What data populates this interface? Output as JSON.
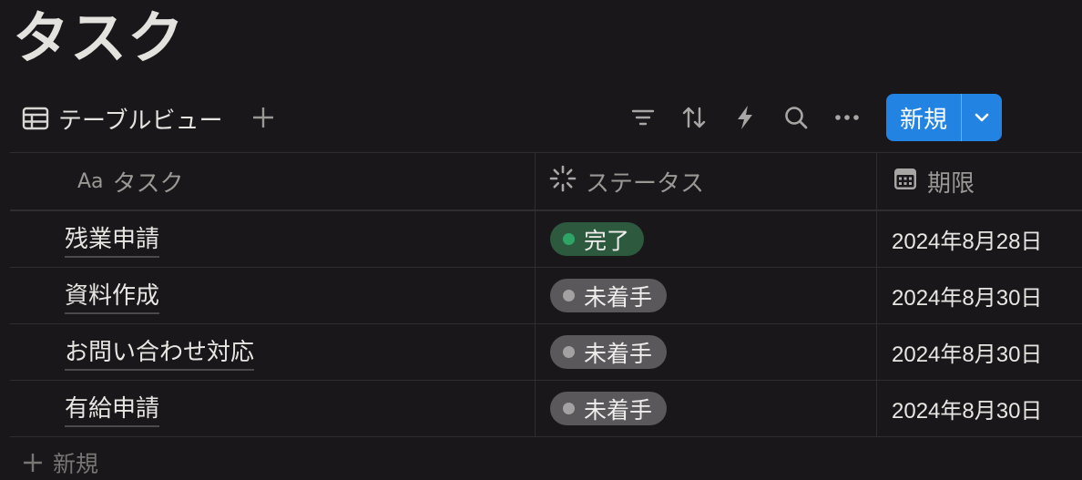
{
  "page": {
    "title": "タスク"
  },
  "toolbar": {
    "view_label": "テーブルビュー",
    "new_label": "新規",
    "icons": [
      "filter-icon",
      "sort-icon",
      "automation-icon",
      "search-icon",
      "more-icon"
    ]
  },
  "columns": {
    "task": {
      "prefix": "Aa",
      "label": "タスク"
    },
    "status": {
      "label": "ステータス"
    },
    "due": {
      "label": "期限"
    }
  },
  "rows": [
    {
      "task": "残業申請",
      "status": "完了",
      "status_color": "#2d5a3f",
      "dot_color": "#2fa565",
      "due": "2024年8月28日"
    },
    {
      "task": "資料作成",
      "status": "未着手",
      "status_color": "#5a585a",
      "dot_color": "#a3a1a2",
      "due": "2024年8月30日"
    },
    {
      "task": "お問い合わせ対応",
      "status": "未着手",
      "status_color": "#5a585a",
      "dot_color": "#a3a1a2",
      "due": "2024年8月30日"
    },
    {
      "task": "有給申請",
      "status": "未着手",
      "status_color": "#5a585a",
      "dot_color": "#a3a1a2",
      "due": "2024年8月30日"
    }
  ],
  "footer": {
    "add_label": "新規"
  },
  "colors": {
    "accent": "#2383e2",
    "background": "#191719"
  }
}
